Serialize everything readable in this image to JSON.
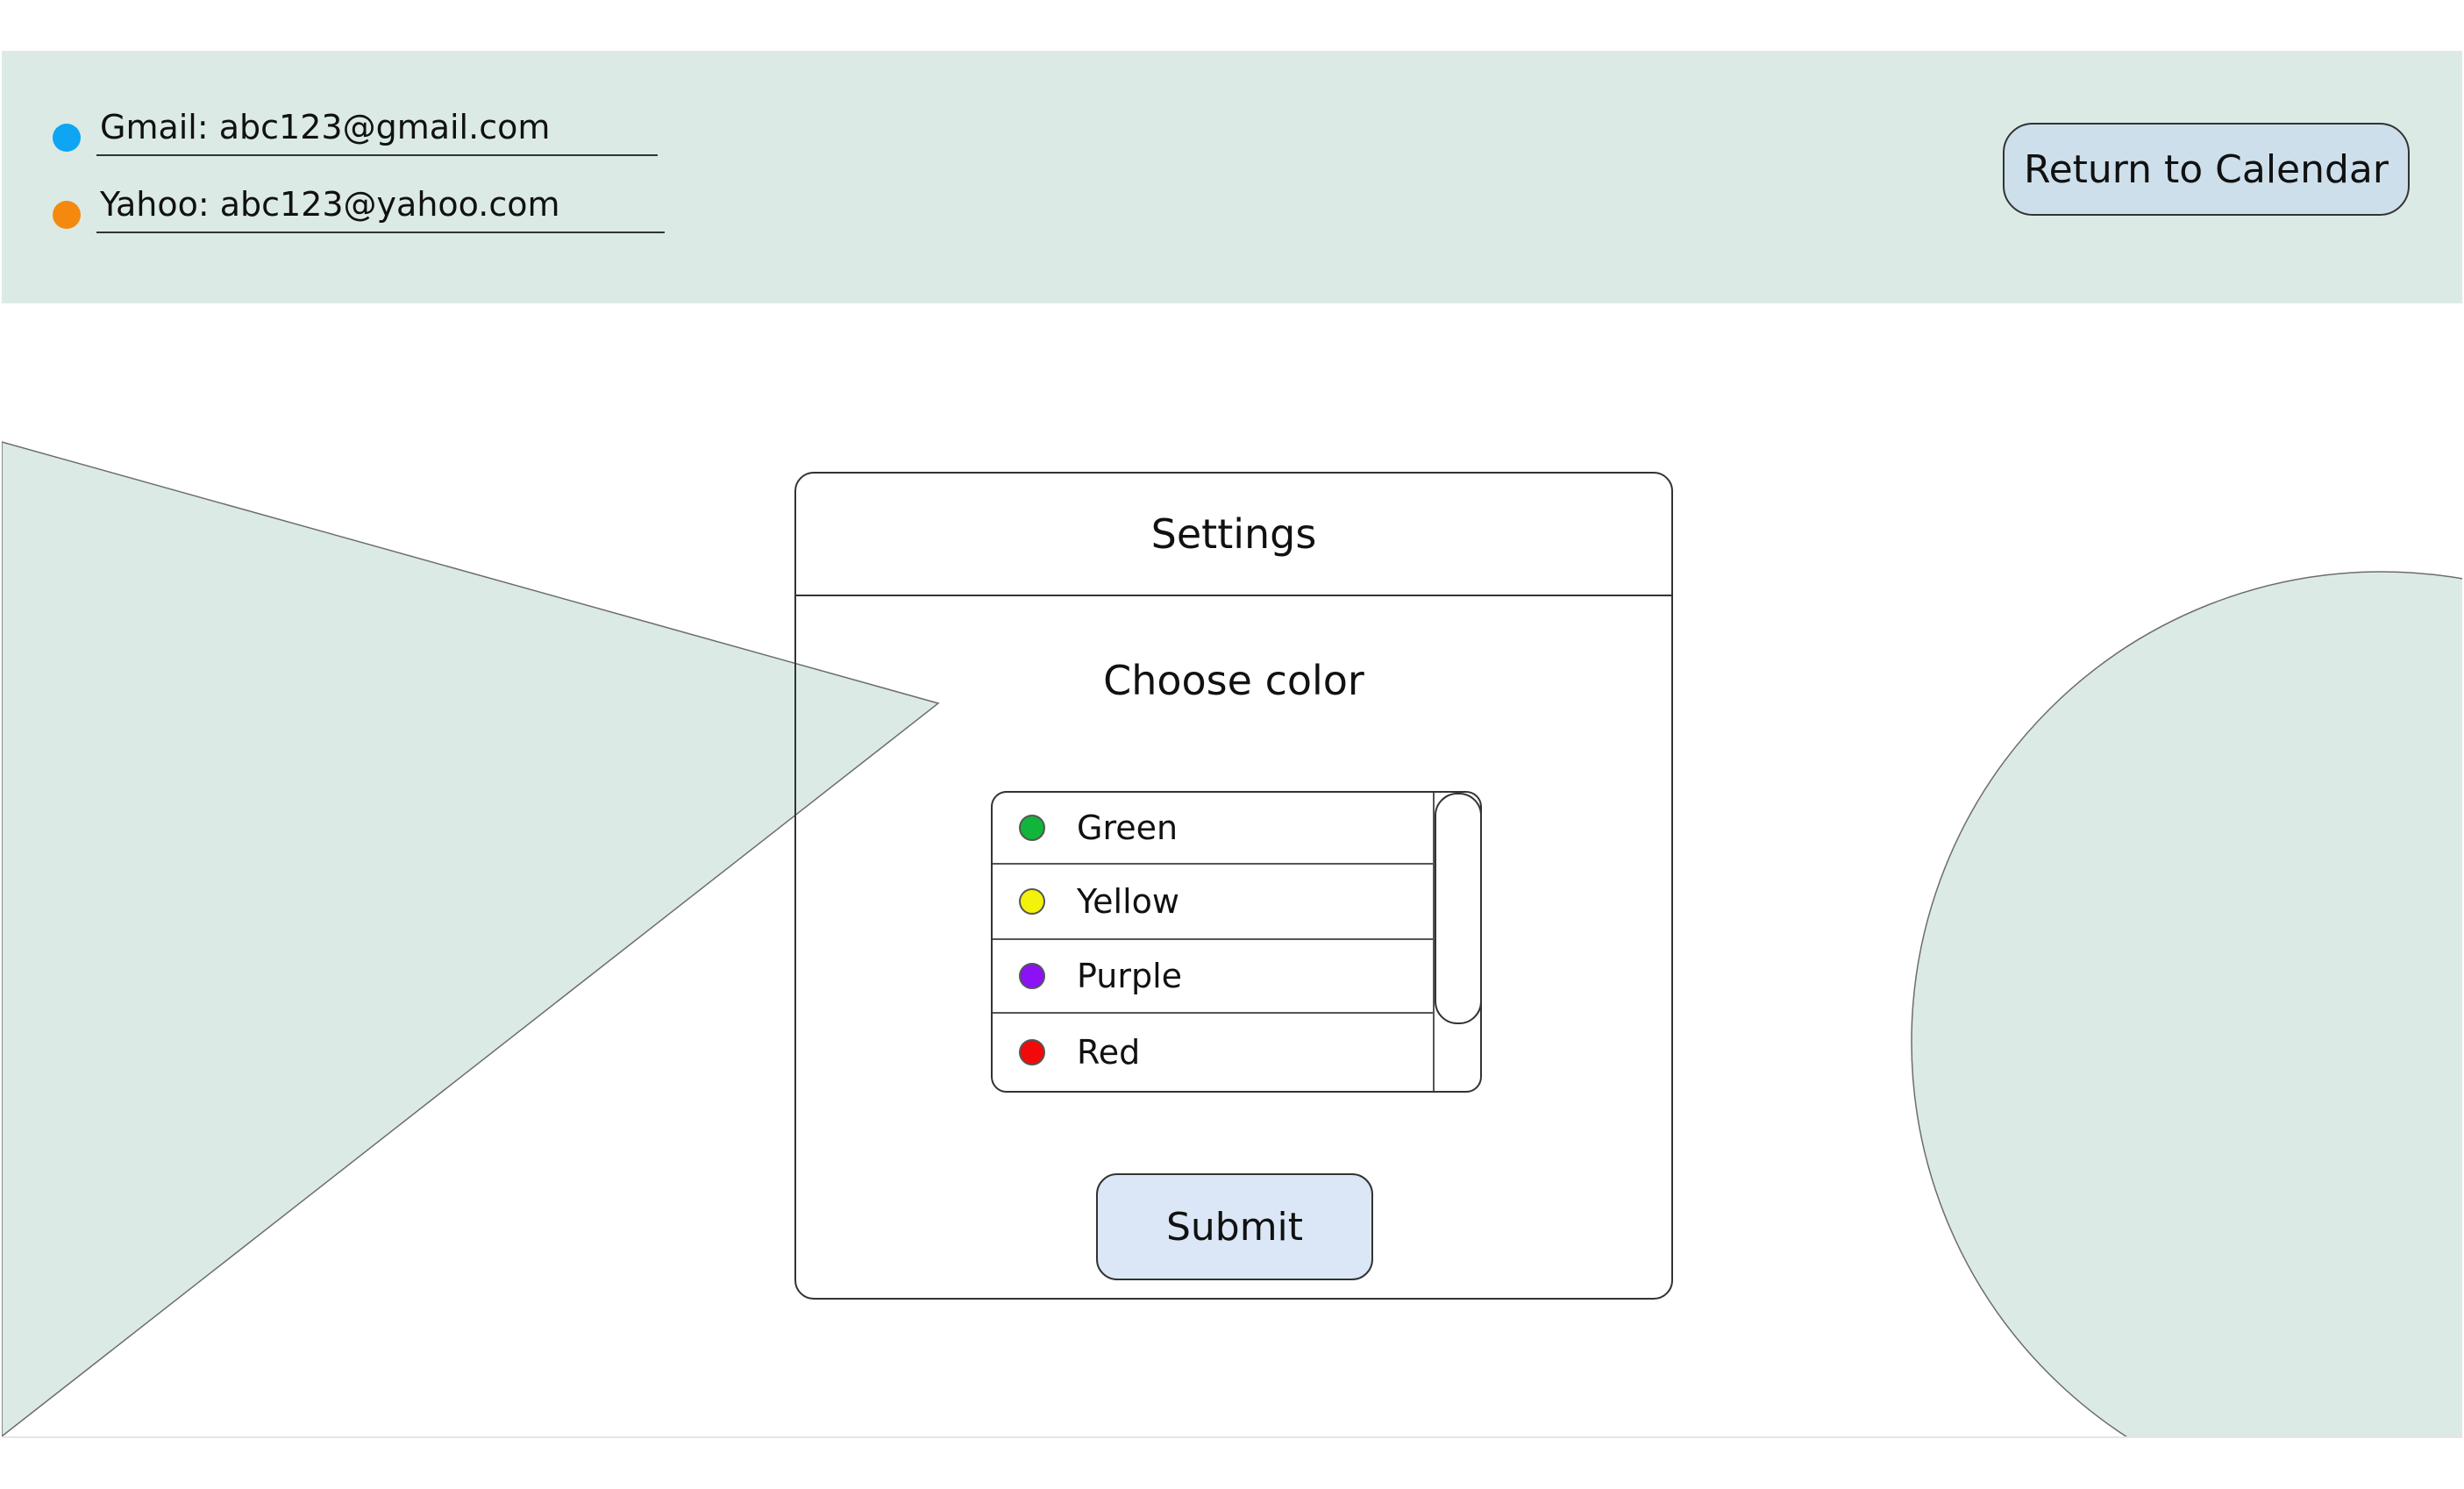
{
  "accounts": [
    {
      "label": "Gmail: abc123@gmail.com",
      "dot_color": "#0ea5f2"
    },
    {
      "label": "Yahoo: abc123@yahoo.com",
      "dot_color": "#f5890f"
    }
  ],
  "header": {
    "return_label": "Return to Calendar"
  },
  "settings": {
    "title": "Settings",
    "choose_label": "Choose color",
    "colors": [
      {
        "name": "Green",
        "swatch": "#10b53a"
      },
      {
        "name": "Yellow",
        "swatch": "#f2f20a"
      },
      {
        "name": "Purple",
        "swatch": "#8a12f5"
      },
      {
        "name": "Red",
        "swatch": "#f20a0a"
      }
    ],
    "submit_label": "Submit"
  },
  "theme": {
    "header_bg": "#dbeae5",
    "shape_fill": "#dbeae5",
    "button_bg": "#cddfea",
    "submit_bg": "#dbe7f6"
  }
}
